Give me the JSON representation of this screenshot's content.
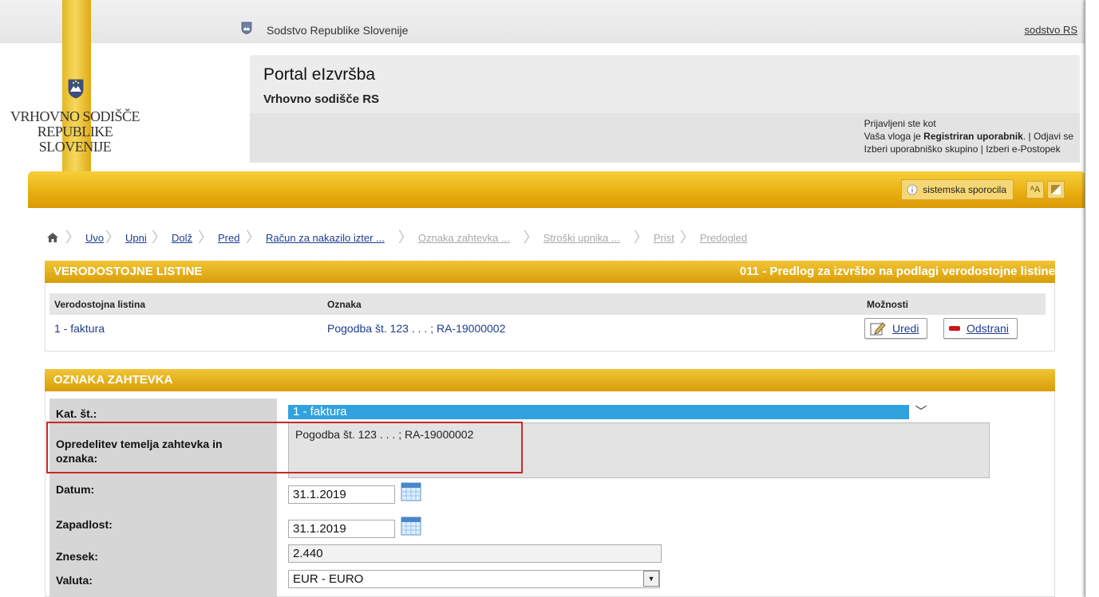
{
  "colors": {
    "gold": "#e8ad10",
    "link": "#1d3c8f",
    "select_blue": "#32a2de",
    "highlight_red": "#c62828"
  },
  "top": {
    "site_name": "Sodstvo Republike Slovenije",
    "link": "sodstvo RS"
  },
  "logo": {
    "line1": "VRHOVNO SODIŠČE",
    "line2": "REPUBLIKE SLOVENIJE"
  },
  "portal": {
    "title": "Portal eIzvršba",
    "subtitle": "Vrhovno sodišče RS"
  },
  "login": {
    "signed_in": "Prijavljeni ste kot",
    "role_prefix": "Vaša vloga je ",
    "role": "Registriran uporabnik",
    "sep1": ". | ",
    "logout": "Odjavi se",
    "choose_group": "Izberi uporabniško skupino",
    "sep2": " | ",
    "choose_procedure": "Izberi e-Postopek"
  },
  "toolbar": {
    "system_messages": "sistemska sporocila",
    "font_tool": "ᴬA"
  },
  "breadcrumb": [
    "Uvoz",
    "Upni",
    "Dolž",
    "Pred",
    "Račun za nakazilo izter ...",
    "Oznaka zahtevka ...",
    "Stroški upnika ...",
    "Prist",
    "Predogled"
  ],
  "section1": {
    "title": "VERODOSTOJNE LISTINE",
    "right": "011 - Predlog za izvršbo na podlagi verodostojne listine"
  },
  "table": {
    "headers": [
      "Verodostojna listina",
      "Oznaka",
      "Možnosti"
    ],
    "row": {
      "doc": "1 - faktura",
      "mark": "Pogodba št. 123 . . . ; RA-19000002"
    },
    "edit": "Uredi",
    "remove": "Odstrani"
  },
  "section2": {
    "title": "OZNAKA ZAHTEVKA"
  },
  "form": {
    "kat_label": "Kat. št.:",
    "kat_value": "1 - faktura",
    "basis_label_1": "Opredelitev temelja zahtevka in",
    "basis_label_2": "oznaka:",
    "basis_value": "Pogodba št. 123 . . . ; RA-19000002",
    "date_label": "Datum:",
    "date_value": "31.1.2019",
    "due_label": "Zapadlost:",
    "due_value": "31.1.2019",
    "amount_label": "Znesek:",
    "amount_value": "2.440",
    "currency_label": "Valuta:",
    "currency_value": "EUR - EURO"
  }
}
